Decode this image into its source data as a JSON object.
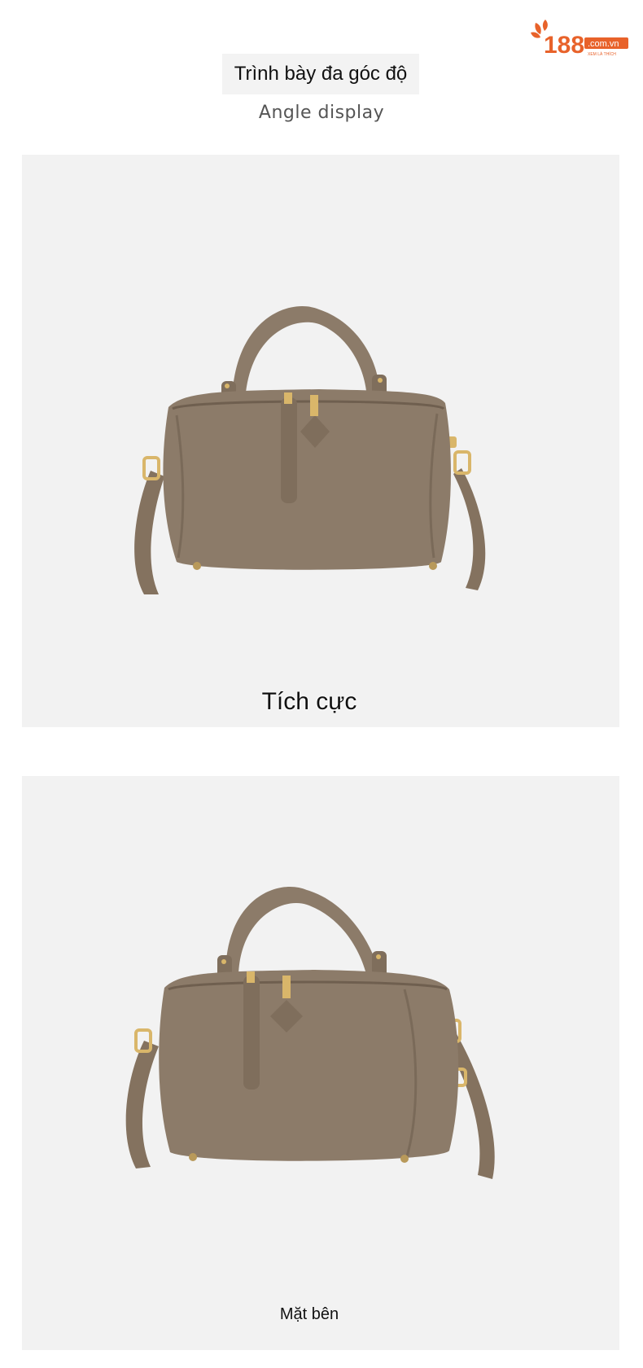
{
  "brand": {
    "logo_text": "188",
    "logo_domain": ".com.vn",
    "logo_tagline": "XEM LÀ THÍCH",
    "color": "#e8622a"
  },
  "header": {
    "title": "Trình bày đa góc độ",
    "subtitle": "Angle display"
  },
  "panels": [
    {
      "caption": "Tích cực",
      "image": "handbag-front-view"
    },
    {
      "caption": "Mặt bên",
      "image": "handbag-side-view"
    }
  ],
  "colors": {
    "leather": "#8c7b69",
    "hardware": "#d9b66a",
    "panel_bg": "#f2f2f2"
  }
}
